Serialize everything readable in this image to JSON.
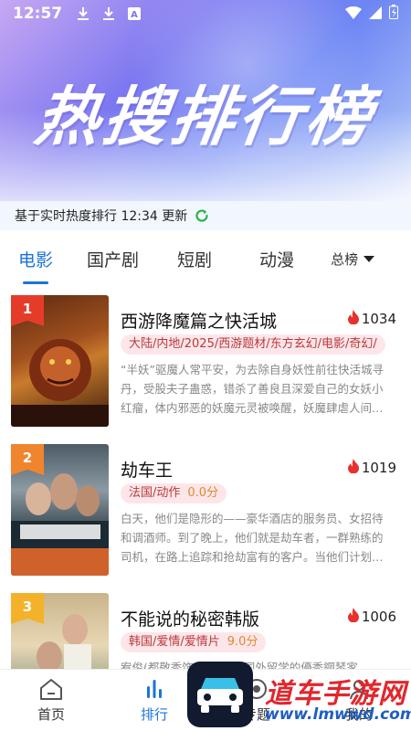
{
  "status_bar": {
    "time": "12:57",
    "icons": [
      "download-icon",
      "download-icon",
      "a-badge-icon",
      "wifi-icon",
      "signal-icon",
      "battery-icon"
    ]
  },
  "header": {
    "title": "热搜排行榜",
    "update_text": "基于实时热度排行 12:34 更新"
  },
  "tabs": {
    "items": [
      {
        "label": "电影"
      },
      {
        "label": "国产剧"
      },
      {
        "label": "短剧"
      },
      {
        "label": "动漫"
      }
    ],
    "active_index": 0,
    "more_label": "总榜"
  },
  "items": [
    {
      "rank": "1",
      "title": "西游降魔篇之快活城",
      "heat": "1034",
      "tags": "大陆/内地/2025/西游题材/东方玄幻/电影/奇幻/",
      "score": "",
      "desc": "“半妖”驱魔人常平安，为去除自身妖性前往快活城寻丹，受股夫子蛊惑，错杀了善良且深爱自己的女妖小红瘤，体内邪恶的妖魔元灵被唤醒，妖魔肆虐人间…"
    },
    {
      "rank": "2",
      "title": "劫车王",
      "heat": "1019",
      "tags": "法国/动作",
      "score": "0.0分",
      "desc": "白天，他们是隐形的——豪华酒店的服务员、女招待和调酒师。到了晚上，他们就是劫车者，一群熟练的司机，在路上追踪和抢劫富有的客户。当他们计划…"
    },
    {
      "rank": "3",
      "title": "不能说的秘密韩版",
      "heat": "1006",
      "tags": "韩国/爱情/爱情片",
      "score": "9.0分",
      "desc": "宥俊(都敬秀饰)是一位在国外留学的優秀鋼琴家，他…"
    }
  ],
  "bottom_nav": [
    {
      "label": "首页",
      "icon": "home-icon"
    },
    {
      "label": "排行",
      "icon": "ranking-icon"
    },
    {
      "label": "专题",
      "icon": "topic-icon"
    },
    {
      "label": "我的",
      "icon": "profile-icon"
    }
  ],
  "watermark": {
    "text": "道车手游网",
    "url": "www.lmwwd.com"
  },
  "colors": {
    "accent": "#1a74d8",
    "rank_1": "#e53c2a",
    "rank_2": "#f0852d",
    "rank_3": "#f4b22b",
    "heat_flame": "#e5322c",
    "tag_bg": "#fde6ea",
    "score": "#e0892a"
  }
}
